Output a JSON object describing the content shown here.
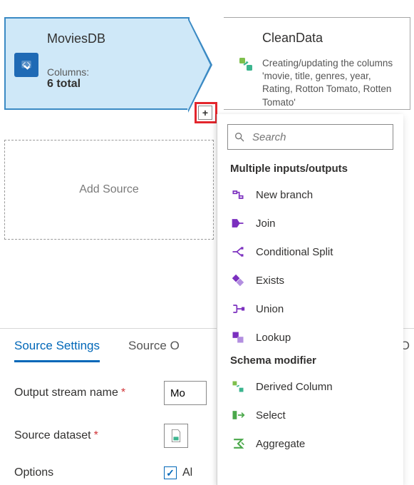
{
  "source_node": {
    "title": "MoviesDB",
    "columns_label": "Columns:",
    "columns_value": "6 total"
  },
  "clean_node": {
    "title": "CleanData",
    "description": "Creating/updating the columns 'movie, title, genres, year, Rating, Rotton Tomato, Rotten Tomato'"
  },
  "add_source_label": "Add Source",
  "plus_label": "+",
  "dropdown": {
    "search_placeholder": "Search",
    "groups": [
      {
        "header": "Multiple inputs/outputs",
        "items": [
          {
            "label": "New branch",
            "icon": "branch-icon"
          },
          {
            "label": "Join",
            "icon": "join-icon"
          },
          {
            "label": "Conditional Split",
            "icon": "split-icon"
          },
          {
            "label": "Exists",
            "icon": "exists-icon"
          },
          {
            "label": "Union",
            "icon": "union-icon"
          },
          {
            "label": "Lookup",
            "icon": "lookup-icon"
          }
        ]
      },
      {
        "header": "Schema modifier",
        "items": [
          {
            "label": "Derived Column",
            "icon": "derived-icon",
            "tone": "teal"
          },
          {
            "label": "Select",
            "icon": "select-icon",
            "tone": "green"
          },
          {
            "label": "Aggregate",
            "icon": "aggregate-icon",
            "tone": "green"
          }
        ]
      }
    ]
  },
  "settings": {
    "tabs": {
      "active": "Source Settings",
      "next": "Source O",
      "right": "O"
    },
    "output_stream_label": "Output stream name",
    "output_stream_value": "Mo",
    "source_dataset_label": "Source dataset",
    "options_label": "Options",
    "options_checkbox_label": "Al",
    "options_checked": true
  }
}
